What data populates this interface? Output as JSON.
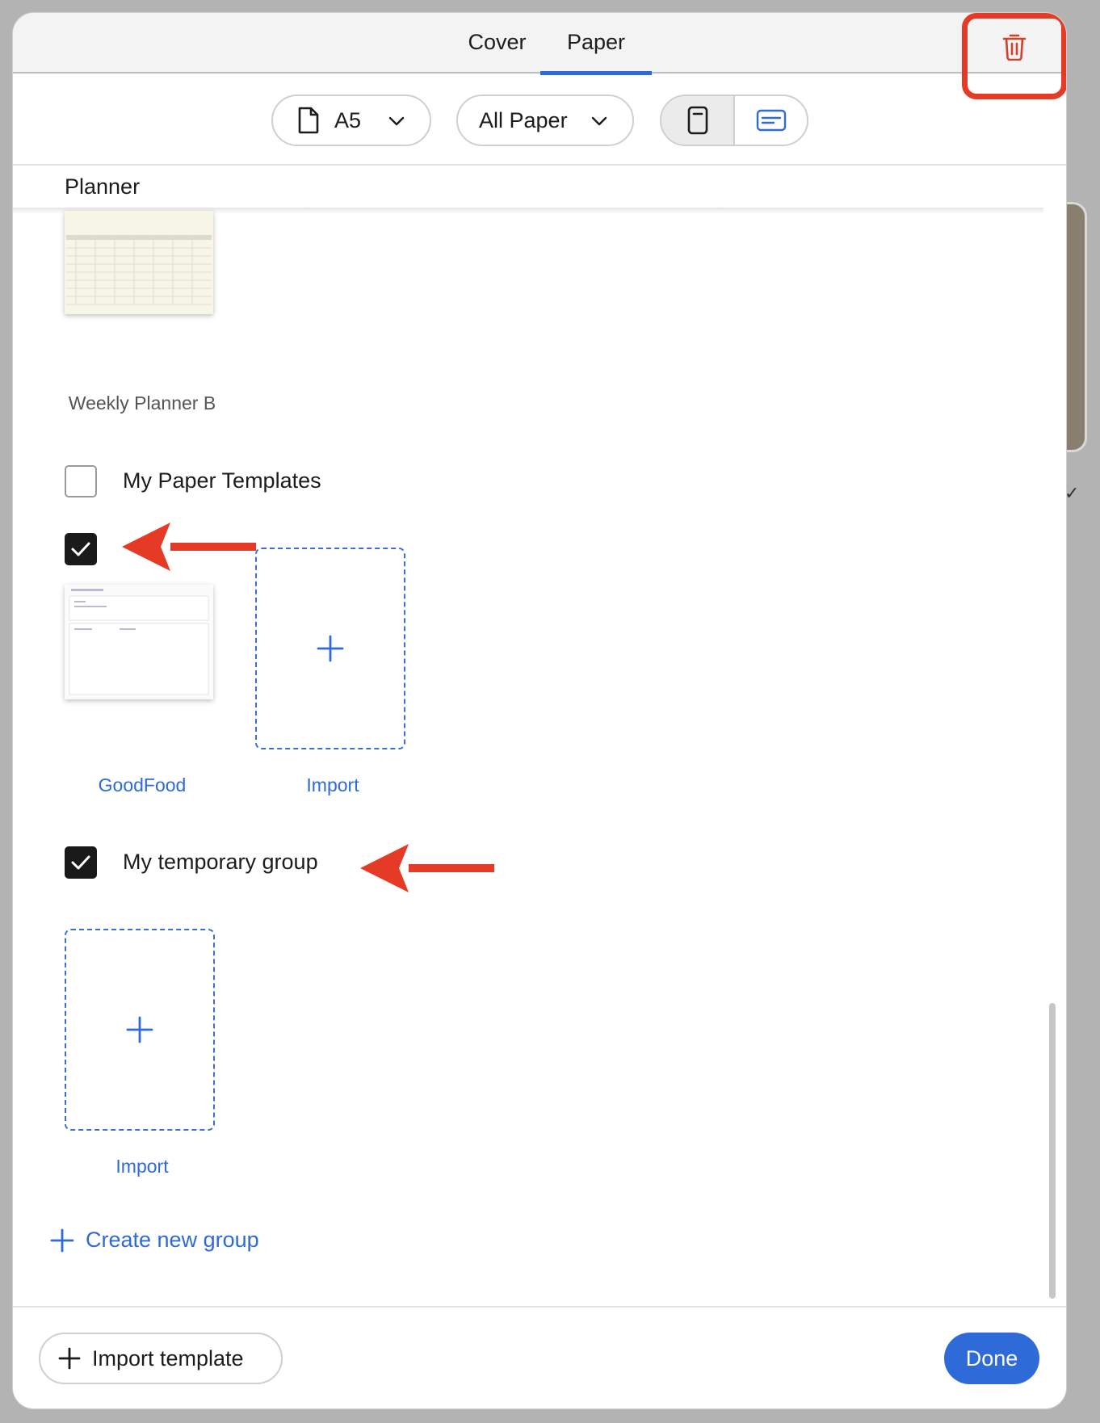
{
  "tabs": [
    {
      "label": "Cover",
      "active": false
    },
    {
      "label": "Paper",
      "active": true
    }
  ],
  "toolbar": {
    "trash_icon": "trash-icon",
    "size_label": "A5",
    "category_label": "All Paper",
    "orientation_options": [
      "portrait",
      "landscape"
    ],
    "orientation_selected": "portrait"
  },
  "sections": {
    "planner": {
      "title": "Planner",
      "template_name": "Weekly Planner B"
    },
    "my_paper_templates": {
      "title": "My Paper Templates",
      "checked": false,
      "subgroup_checked": true,
      "templates": [
        {
          "name": "GoodFood"
        }
      ],
      "import_label": "Import"
    },
    "my_temporary_group": {
      "title": "My temporary group",
      "checked": true,
      "import_label": "Import"
    }
  },
  "create_group_label": "Create new group",
  "footer": {
    "import_template_label": "Import template",
    "done_label": "Done"
  },
  "colors": {
    "accent": "#2f6bd8",
    "annotation": "#e53a26",
    "checkbox_checked": "#1a1a1a"
  }
}
